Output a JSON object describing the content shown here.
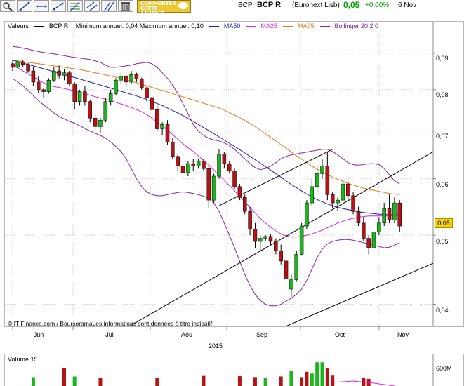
{
  "toolbar": {
    "tools": [
      {
        "name": "zoom-tool-icon"
      },
      {
        "name": "line-tool-icon"
      },
      {
        "name": "horizontal-line-tool-icon"
      },
      {
        "name": "fibonacci-tool-icon"
      },
      {
        "name": "channel-tool-icon"
      },
      {
        "name": "parallel-lines-tool-icon"
      },
      {
        "name": "trash-icon"
      }
    ],
    "analyse_label_1": "COMMENTER",
    "analyse_label_2": "CETTE",
    "analyse_label_3": "ANALYSE"
  },
  "quote": {
    "ticker": "BCP",
    "name": "BCP R",
    "market": "(Euronext Lisb)",
    "price": "0,05",
    "change": "+0,00%",
    "date": "6 Nov",
    "price_color": "#00a000"
  },
  "legend": {
    "valeurs": "Valeurs",
    "series_name": "BCP R",
    "min_max": "Minimum annuel: 0,04 Maximum annuel: 0,10",
    "ma50": "MA50",
    "ma25": "MA25",
    "ma75": "MA75",
    "bollinger": "Bollinger 20 2.0",
    "colors": {
      "ma50": "#1e1eb4",
      "ma25": "#e61ee6",
      "ma75": "#e87a14",
      "bollinger": "#8c1eaa",
      "up": "#1eb41e",
      "down": "#b41414"
    }
  },
  "copyright": "© IT-Finance.com / BoursoramaLes informations sont données à titre indicatif",
  "last_price_tag": "0,05",
  "volume": {
    "title": "Volume 15",
    "tick": "600M"
  },
  "chart_data": {
    "type": "candlestick",
    "series_name": "BCP R",
    "x_axis": {
      "labels": [
        "Jun",
        "Jul",
        "Aou",
        "Sep",
        "Oct",
        "Nov"
      ],
      "year_label": "2015"
    },
    "y_axis": {
      "ticks": [
        0.04,
        0.05,
        0.06,
        0.07,
        0.08,
        0.09
      ],
      "tick_labels": [
        "0,04",
        "0,05",
        "0,06",
        "0,07",
        "0,08",
        "0,09"
      ],
      "scale": "log",
      "range": [
        0.0375,
        0.095
      ]
    },
    "candles": [
      [
        0.087,
        0.088,
        0.085,
        0.086
      ],
      [
        0.086,
        0.088,
        0.0855,
        0.0875
      ],
      [
        0.0875,
        0.088,
        0.086,
        0.0868
      ],
      [
        0.0868,
        0.0872,
        0.0845,
        0.085
      ],
      [
        0.085,
        0.086,
        0.081,
        0.082
      ],
      [
        0.082,
        0.0835,
        0.079,
        0.08
      ],
      [
        0.08,
        0.0805,
        0.078,
        0.0795
      ],
      [
        0.0795,
        0.083,
        0.079,
        0.0825
      ],
      [
        0.0825,
        0.086,
        0.082,
        0.085
      ],
      [
        0.085,
        0.0865,
        0.083,
        0.0838
      ],
      [
        0.0838,
        0.0855,
        0.0825,
        0.0845
      ],
      [
        0.0845,
        0.085,
        0.081,
        0.0815
      ],
      [
        0.0815,
        0.082,
        0.075,
        0.077
      ],
      [
        0.077,
        0.08,
        0.076,
        0.0795
      ],
      [
        0.0795,
        0.081,
        0.076,
        0.077
      ],
      [
        0.077,
        0.0775,
        0.072,
        0.073
      ],
      [
        0.073,
        0.074,
        0.07,
        0.071
      ],
      [
        0.071,
        0.073,
        0.0695,
        0.0725
      ],
      [
        0.0725,
        0.078,
        0.072,
        0.077
      ],
      [
        0.077,
        0.08,
        0.076,
        0.079
      ],
      [
        0.079,
        0.083,
        0.0785,
        0.0825
      ],
      [
        0.0825,
        0.0845,
        0.0815,
        0.0835
      ],
      [
        0.0835,
        0.084,
        0.081,
        0.082
      ],
      [
        0.082,
        0.085,
        0.0815,
        0.084
      ],
      [
        0.084,
        0.0845,
        0.082,
        0.0828
      ],
      [
        0.0828,
        0.0832,
        0.08,
        0.0805
      ],
      [
        0.0805,
        0.081,
        0.077,
        0.078
      ],
      [
        0.078,
        0.079,
        0.074,
        0.075
      ],
      [
        0.075,
        0.076,
        0.07,
        0.0705
      ],
      [
        0.0705,
        0.072,
        0.069,
        0.0715
      ],
      [
        0.0715,
        0.0725,
        0.067,
        0.0675
      ],
      [
        0.0675,
        0.0685,
        0.064,
        0.0645
      ],
      [
        0.0645,
        0.065,
        0.0615,
        0.0625
      ],
      [
        0.0625,
        0.063,
        0.06,
        0.0612
      ],
      [
        0.0612,
        0.0635,
        0.0605,
        0.063
      ],
      [
        0.063,
        0.064,
        0.0615,
        0.0625
      ],
      [
        0.0625,
        0.064,
        0.062,
        0.0635
      ],
      [
        0.0635,
        0.064,
        0.0615,
        0.062
      ],
      [
        0.062,
        0.0625,
        0.0545,
        0.056
      ],
      [
        0.056,
        0.061,
        0.0555,
        0.0605
      ],
      [
        0.0605,
        0.066,
        0.06,
        0.065
      ],
      [
        0.065,
        0.0655,
        0.062,
        0.063
      ],
      [
        0.063,
        0.0635,
        0.061,
        0.0615
      ],
      [
        0.0615,
        0.062,
        0.058,
        0.0585
      ],
      [
        0.0585,
        0.059,
        0.056,
        0.0565
      ],
      [
        0.0565,
        0.057,
        0.0535,
        0.054
      ],
      [
        0.054,
        0.0548,
        0.05,
        0.051
      ],
      [
        0.051,
        0.052,
        0.048,
        0.049
      ],
      [
        0.049,
        0.05,
        0.0475,
        0.0495
      ],
      [
        0.0495,
        0.05,
        0.049,
        0.0498
      ],
      [
        0.0498,
        0.0502,
        0.0485,
        0.049
      ],
      [
        0.049,
        0.0495,
        0.047,
        0.0475
      ],
      [
        0.0475,
        0.0485,
        0.0455,
        0.046
      ],
      [
        0.046,
        0.0465,
        0.043,
        0.0435
      ],
      [
        0.042,
        0.044,
        0.041,
        0.0433
      ],
      [
        0.0433,
        0.0475,
        0.043,
        0.047
      ],
      [
        0.047,
        0.052,
        0.0468,
        0.0515
      ],
      [
        0.0515,
        0.056,
        0.051,
        0.0555
      ],
      [
        0.0555,
        0.06,
        0.055,
        0.0585
      ],
      [
        0.0585,
        0.0625,
        0.0575,
        0.061
      ],
      [
        0.061,
        0.064,
        0.06,
        0.0625
      ],
      [
        0.0625,
        0.0655,
        0.056,
        0.057
      ],
      [
        0.057,
        0.0575,
        0.0545,
        0.0555
      ],
      [
        0.0555,
        0.0565,
        0.054,
        0.056
      ],
      [
        0.056,
        0.06,
        0.0555,
        0.059
      ],
      [
        0.059,
        0.0595,
        0.056,
        0.0568
      ],
      [
        0.0568,
        0.0575,
        0.0535,
        0.054
      ],
      [
        0.054,
        0.0548,
        0.0515,
        0.052
      ],
      [
        0.052,
        0.053,
        0.049,
        0.0495
      ],
      [
        0.0495,
        0.05,
        0.047,
        0.048
      ],
      [
        0.048,
        0.051,
        0.0475,
        0.0505
      ],
      [
        0.0505,
        0.053,
        0.05,
        0.052
      ],
      [
        0.052,
        0.0555,
        0.0515,
        0.0545
      ],
      [
        0.0545,
        0.057,
        0.052,
        0.0525
      ],
      [
        0.0525,
        0.0565,
        0.052,
        0.0555
      ],
      [
        0.0555,
        0.056,
        0.0505,
        0.0515
      ]
    ],
    "ma25": [
      0.0866,
      0.0858,
      0.085,
      0.0842,
      0.0834,
      0.0826,
      0.0818,
      0.0812,
      0.0808,
      0.0806,
      0.0803,
      0.08,
      0.0797,
      0.0793,
      0.079,
      0.0786,
      0.0782,
      0.0779,
      0.0776,
      0.0772,
      0.0768,
      0.0764,
      0.076,
      0.0755,
      0.075,
      0.0745,
      0.0738,
      0.073,
      0.0721,
      0.0712,
      0.0702,
      0.0692,
      0.0682,
      0.0672,
      0.0663,
      0.0655,
      0.0646,
      0.0637,
      0.0627,
      0.0617,
      0.0607,
      0.0597,
      0.0587,
      0.0577,
      0.0567,
      0.0557,
      0.0547,
      0.0537,
      0.0528,
      0.052,
      0.0513,
      0.0507,
      0.0502,
      0.0499,
      0.0497,
      0.0497,
      0.0498,
      0.05,
      0.0502,
      0.0505,
      0.0508,
      0.0512,
      0.0516,
      0.052,
      0.0523,
      0.0526,
      0.0528,
      0.053,
      0.0531,
      0.0532,
      0.0532,
      0.0532,
      0.0532,
      0.0532,
      0.0533,
      0.0533
    ],
    "ma50": [
      0.088,
      0.0876,
      0.0872,
      0.0868,
      0.0864,
      0.086,
      0.0856,
      0.0852,
      0.0848,
      0.0844,
      0.084,
      0.0836,
      0.0832,
      0.0828,
      0.0824,
      0.082,
      0.0816,
      0.0812,
      0.0808,
      0.0804,
      0.08,
      0.0796,
      0.0792,
      0.0788,
      0.0784,
      0.078,
      0.0775,
      0.077,
      0.0765,
      0.076,
      0.0754,
      0.0748,
      0.0742,
      0.0736,
      0.0729,
      0.0722,
      0.0715,
      0.0708,
      0.0701,
      0.0694,
      0.0687,
      0.068,
      0.0673,
      0.0666,
      0.0659,
      0.0652,
      0.0645,
      0.0638,
      0.0631,
      0.0624,
      0.0617,
      0.061,
      0.0603,
      0.0596,
      0.0589,
      0.0583,
      0.0577,
      0.0571,
      0.0566,
      0.0561,
      0.0557,
      0.0553,
      0.055,
      0.0547,
      0.0545,
      0.0543,
      0.0541,
      0.0539,
      0.0538,
      0.0537,
      0.0536,
      0.0535,
      0.0535,
      0.0534,
      0.0534,
      0.0534
    ],
    "ma75": [
      0.088,
      0.0878,
      0.0876,
      0.0874,
      0.0872,
      0.087,
      0.0868,
      0.0866,
      0.0864,
      0.0862,
      0.086,
      0.0858,
      0.0856,
      0.0854,
      0.0851,
      0.0848,
      0.0845,
      0.0842,
      0.0839,
      0.0836,
      0.0833,
      0.083,
      0.0826,
      0.0822,
      0.0818,
      0.0814,
      0.081,
      0.0806,
      0.0802,
      0.0798,
      0.0794,
      0.079,
      0.0786,
      0.0782,
      0.0778,
      0.0774,
      0.077,
      0.0766,
      0.0762,
      0.0758,
      0.0754,
      0.0749,
      0.0743,
      0.0737,
      0.0731,
      0.0724,
      0.0717,
      0.071,
      0.0702,
      0.0694,
      0.0686,
      0.0678,
      0.067,
      0.0662,
      0.0654,
      0.0646,
      0.0639,
      0.0632,
      0.0625,
      0.0619,
      0.0613,
      0.0608,
      0.0603,
      0.0599,
      0.0595,
      0.0591,
      0.0588,
      0.0585,
      0.0582,
      0.058,
      0.0578,
      0.0576,
      0.0574,
      0.0572,
      0.0571,
      0.057
    ],
    "bollinger_upper": [
      0.092,
      0.0918,
      0.0915,
      0.0912,
      0.0908,
      0.0905,
      0.0902,
      0.09,
      0.0898,
      0.0895,
      0.0893,
      0.089,
      0.0888,
      0.0886,
      0.0884,
      0.0882,
      0.0878,
      0.0874,
      0.0866,
      0.086,
      0.086,
      0.0862,
      0.0864,
      0.0866,
      0.087,
      0.0872,
      0.0874,
      0.087,
      0.086,
      0.0845,
      0.083,
      0.0812,
      0.079,
      0.0765,
      0.074,
      0.0715,
      0.07,
      0.069,
      0.0684,
      0.068,
      0.0678,
      0.0674,
      0.0668,
      0.066,
      0.065,
      0.064,
      0.063,
      0.0622,
      0.0618,
      0.062,
      0.0625,
      0.0632,
      0.064,
      0.0645,
      0.0648,
      0.065,
      0.0652,
      0.0654,
      0.0656,
      0.0658,
      0.066,
      0.066,
      0.0655,
      0.0648,
      0.064,
      0.0632,
      0.0628,
      0.0627,
      0.0628,
      0.063,
      0.063,
      0.0628,
      0.062,
      0.0608,
      0.0596,
      0.059
    ],
    "bollinger_lower": [
      0.083,
      0.082,
      0.081,
      0.0798,
      0.0785,
      0.0772,
      0.0762,
      0.0752,
      0.0742,
      0.0734,
      0.0728,
      0.0722,
      0.0718,
      0.0712,
      0.0706,
      0.07,
      0.0695,
      0.069,
      0.0684,
      0.0676,
      0.0666,
      0.0655,
      0.064,
      0.062,
      0.06,
      0.0585,
      0.0575,
      0.057,
      0.0568,
      0.0568,
      0.057,
      0.0572,
      0.0574,
      0.0575,
      0.0574,
      0.0572,
      0.057,
      0.0567,
      0.0563,
      0.0555,
      0.054,
      0.052,
      0.05,
      0.048,
      0.046,
      0.044,
      0.0425,
      0.0413,
      0.0405,
      0.04,
      0.0398,
      0.0398,
      0.04,
      0.0404,
      0.0408,
      0.0413,
      0.042,
      0.0432,
      0.0448,
      0.0465,
      0.0478,
      0.0486,
      0.049,
      0.0492,
      0.0493,
      0.0493,
      0.0492,
      0.049,
      0.0488,
      0.0486,
      0.0484,
      0.0482,
      0.048,
      0.0481,
      0.0484,
      0.0488
    ],
    "trend_lines": [
      [
        [
          0,
          0.03
        ],
        [
          105,
          0.082
        ]
      ],
      [
        [
          52,
          0.037
        ],
        [
          105,
          0.054
        ]
      ],
      [
        [
          40,
          0.055
        ],
        [
          62,
          0.066
        ]
      ]
    ],
    "volume_bars": [
      [
        4,
        300,
        "up"
      ],
      [
        10,
        600,
        "down"
      ],
      [
        12,
        320,
        "up"
      ],
      [
        17,
        280,
        "down"
      ],
      [
        28,
        270,
        "down"
      ],
      [
        37,
        340,
        "down"
      ],
      [
        44,
        330,
        "down"
      ],
      [
        47,
        300,
        "down"
      ],
      [
        49,
        280,
        "up"
      ],
      [
        52,
        320,
        "down"
      ],
      [
        54,
        520,
        "up"
      ],
      [
        56,
        300,
        "down"
      ],
      [
        57,
        480,
        "down"
      ],
      [
        58,
        420,
        "up"
      ],
      [
        59,
        800,
        "up"
      ],
      [
        60,
        800,
        "up"
      ],
      [
        61,
        600,
        "down"
      ],
      [
        62,
        350,
        "down"
      ],
      [
        68,
        260,
        "down"
      ],
      [
        69,
        240,
        "down"
      ]
    ],
    "volume_max": 900
  }
}
